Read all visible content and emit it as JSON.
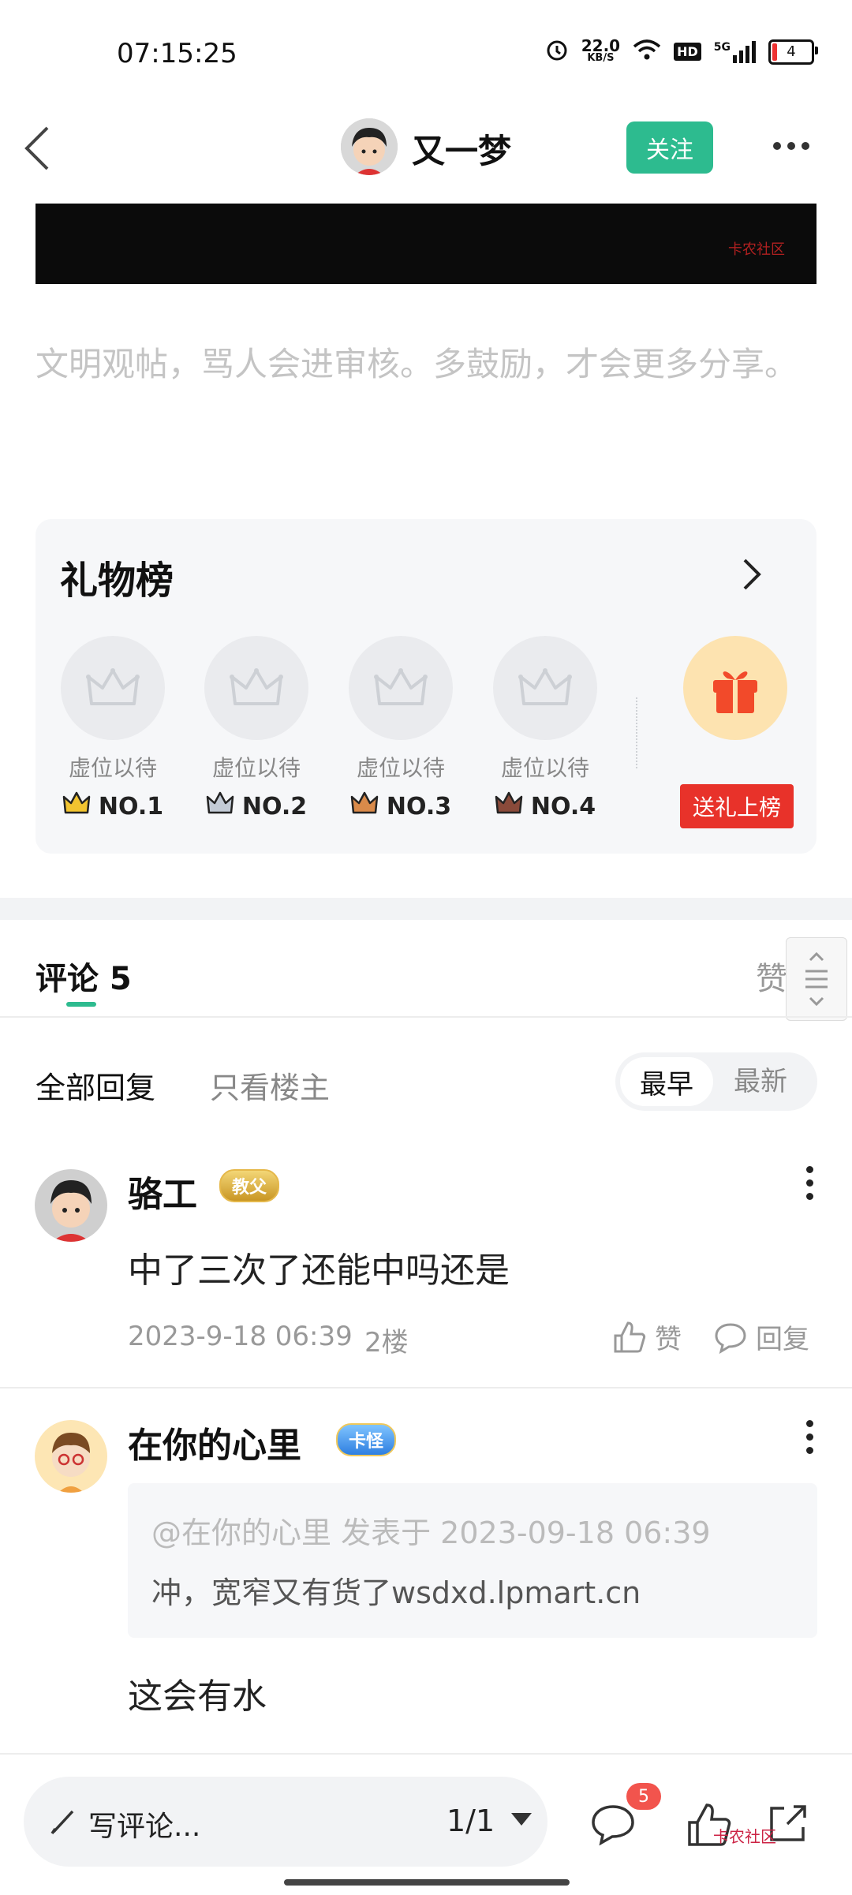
{
  "status_bar": {
    "time": "07:15:25",
    "net_speed": "22.0",
    "net_unit": "KB/S",
    "hd": "HD",
    "net_type": "5G",
    "battery": "4"
  },
  "header": {
    "author": "又一梦",
    "follow_label": "关注"
  },
  "hero": {
    "watermark": "卡农社区"
  },
  "notice": "文明观帖，骂人会进审核。多鼓励，才会更多分享。",
  "gift_board": {
    "title": "礼物榜",
    "slots": [
      {
        "label": "虚位以待",
        "rank": "NO.1",
        "crown_color": "#f2c430"
      },
      {
        "label": "虚位以待",
        "rank": "NO.2",
        "crown_color": "#c3cbd6"
      },
      {
        "label": "虚位以待",
        "rank": "NO.3",
        "crown_color": "#d98a4a"
      },
      {
        "label": "虚位以待",
        "rank": "NO.4",
        "crown_color": "#8a4a3a"
      }
    ],
    "send_label": "送礼上榜"
  },
  "comments_tabs": {
    "comments_label": "评论 5",
    "likes_label": "赞"
  },
  "filters": {
    "all": "全部回复",
    "op_only": "只看楼主",
    "sort_earliest": "最早",
    "sort_newest": "最新"
  },
  "comments": [
    {
      "name": "骆工",
      "badge": "教父",
      "text": "中了三次了还能中吗还是",
      "date": "2023-9-18 06:39",
      "floor": "2楼",
      "like_label": "赞",
      "reply_label": "回复"
    },
    {
      "name": "在你的心里",
      "badge": "卡怪",
      "quote_header": "@在你的心里 发表于 2023-09-18 06:39",
      "quote_body": "冲，宽窄又有货了wsdxd.lpmart.cn",
      "text": "这会有水"
    }
  ],
  "bottom_bar": {
    "write_label": "写评论...",
    "page_indicator": "1/1",
    "comment_count": "5",
    "watermark": "卡农社区"
  },
  "colors": {
    "accent": "#2dbb8f",
    "gift_red": "#e8322a",
    "badge_red": "#f2544d"
  }
}
